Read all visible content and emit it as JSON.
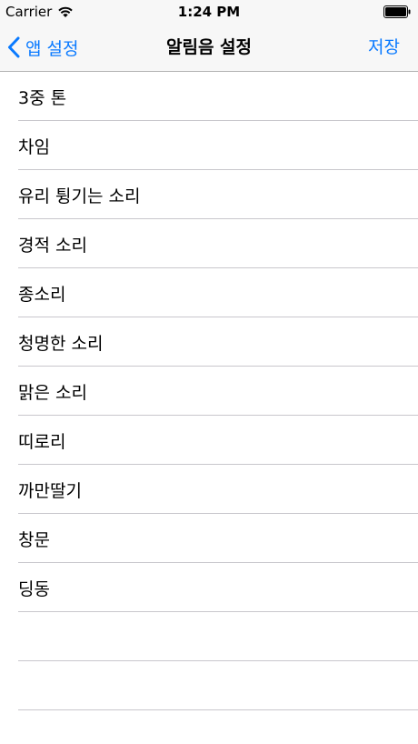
{
  "status_bar": {
    "carrier": "Carrier",
    "time": "1:24 PM"
  },
  "nav": {
    "back_label": "앱 설정",
    "title": "알림음 설정",
    "save_label": "저장",
    "accent_color": "#0a7aff"
  },
  "sounds": [
    "3중 톤",
    "차임",
    "유리 튕기는 소리",
    "경적 소리",
    "종소리",
    "청명한 소리",
    "맑은 소리",
    "띠로리",
    "까만딸기",
    "창문",
    "딩동"
  ]
}
